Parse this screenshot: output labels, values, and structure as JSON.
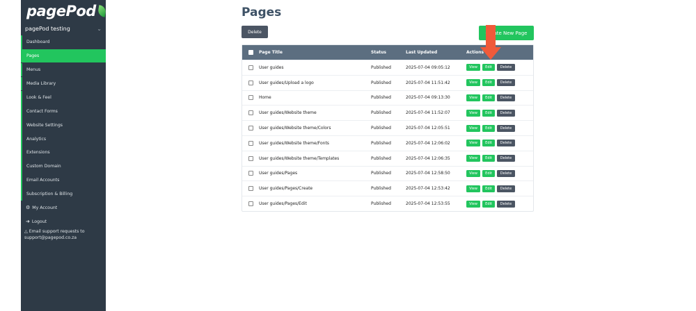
{
  "sidebar": {
    "logo": "pagePod",
    "site_name": "pagePod testing",
    "items": [
      {
        "label": "Dashboard"
      },
      {
        "label": "Pages"
      },
      {
        "label": "Menus"
      },
      {
        "label": "Media Library"
      },
      {
        "label": "Look & Feel"
      },
      {
        "label": "Contact Forms"
      },
      {
        "label": "Website Settings"
      },
      {
        "label": "Analytics"
      },
      {
        "label": "Extensions"
      },
      {
        "label": "Custom Domain"
      },
      {
        "label": "Email Accounts"
      },
      {
        "label": "Subscription & Billing"
      },
      {
        "label": "My Account",
        "icon": "gear-icon"
      },
      {
        "label": "Logout",
        "icon": "logout-icon"
      }
    ],
    "support": "Email support requests to support@pagepod.co.za"
  },
  "main": {
    "title": "Pages",
    "delete_label": "Delete",
    "create_label": "Create New Page",
    "columns": [
      "Page Title",
      "Status",
      "Last Updated",
      "Actions"
    ],
    "action_labels": {
      "view": "View",
      "edit": "Edit",
      "delete": "Delete"
    },
    "rows": [
      {
        "title": "User guides",
        "status": "Published",
        "updated": "2025-07-04 09:05:12"
      },
      {
        "title": "User guides/Upload a logo",
        "status": "Published",
        "updated": "2025-07-04 11:51:42"
      },
      {
        "title": "Home",
        "status": "Published",
        "updated": "2025-07-04 09:13:30"
      },
      {
        "title": "User guides/Website theme",
        "status": "Published",
        "updated": "2025-07-04 11:52:07"
      },
      {
        "title": "User guides/Website theme/Colors",
        "status": "Published",
        "updated": "2025-07-04 12:05:51"
      },
      {
        "title": "User guides/Website theme/Fonts",
        "status": "Published",
        "updated": "2025-07-04 12:06:02"
      },
      {
        "title": "User guides/Website theme/Templates",
        "status": "Published",
        "updated": "2025-07-04 12:06:35"
      },
      {
        "title": "User guides/Pages",
        "status": "Published",
        "updated": "2025-07-04 12:58:50"
      },
      {
        "title": "User guides/Pages/Create",
        "status": "Published",
        "updated": "2025-07-04 12:53:42"
      },
      {
        "title": "User guides/Pages/Edit",
        "status": "Published",
        "updated": "2025-07-04 12:53:55"
      }
    ]
  },
  "colors": {
    "accent": "#22c55e",
    "sidebar": "#2e3a46",
    "header": "#5c6e80",
    "arrow": "#f05a3a"
  }
}
